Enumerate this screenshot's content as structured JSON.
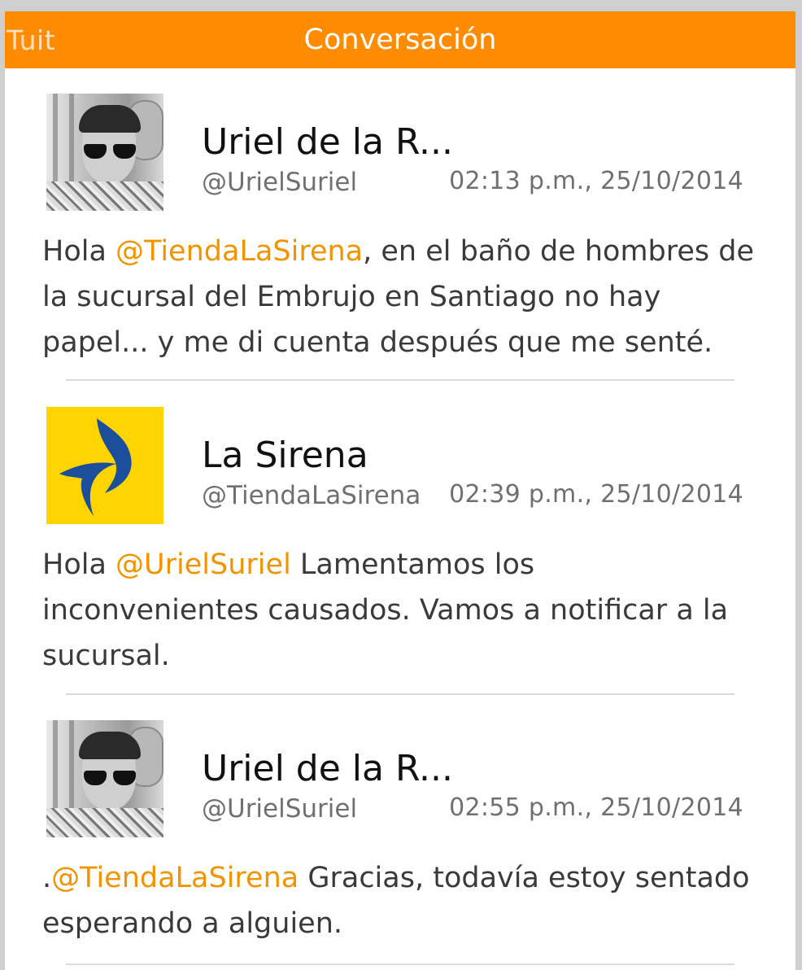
{
  "header": {
    "back_label": "Tuit",
    "title": "Conversación"
  },
  "colors": {
    "header_bg": "#ff8c00",
    "mention": "#f29400",
    "logo_yellow": "#ffd400",
    "logo_blue": "#1b4f9c"
  },
  "tweets": [
    {
      "avatar": "user-photo-avatar",
      "name": "Uriel de la R...",
      "handle": "@UrielSuriel",
      "time": "02:13 p.m., 25/10/2014",
      "text_before": "Hola ",
      "mention": "@TiendaLaSirena",
      "text_after": ", en el baño de hombres de la sucursal del Embrujo en Santiago no hay papel... y me di cuenta después que me senté."
    },
    {
      "avatar": "la-sirena-logo-avatar",
      "name": "La Sirena",
      "handle": "@TiendaLaSirena",
      "time": "02:39 p.m., 25/10/2014",
      "text_before": "Hola ",
      "mention": "@UrielSuriel",
      "text_after": " Lamentamos los inconvenientes causados. Vamos a notificar a la sucursal."
    },
    {
      "avatar": "user-photo-avatar",
      "name": "Uriel de la R...",
      "handle": "@UrielSuriel",
      "time": "02:55 p.m., 25/10/2014",
      "text_before": ".",
      "mention": "@TiendaLaSirena",
      "text_after": " Gracias, todavía estoy sentado esperando a alguien."
    }
  ]
}
